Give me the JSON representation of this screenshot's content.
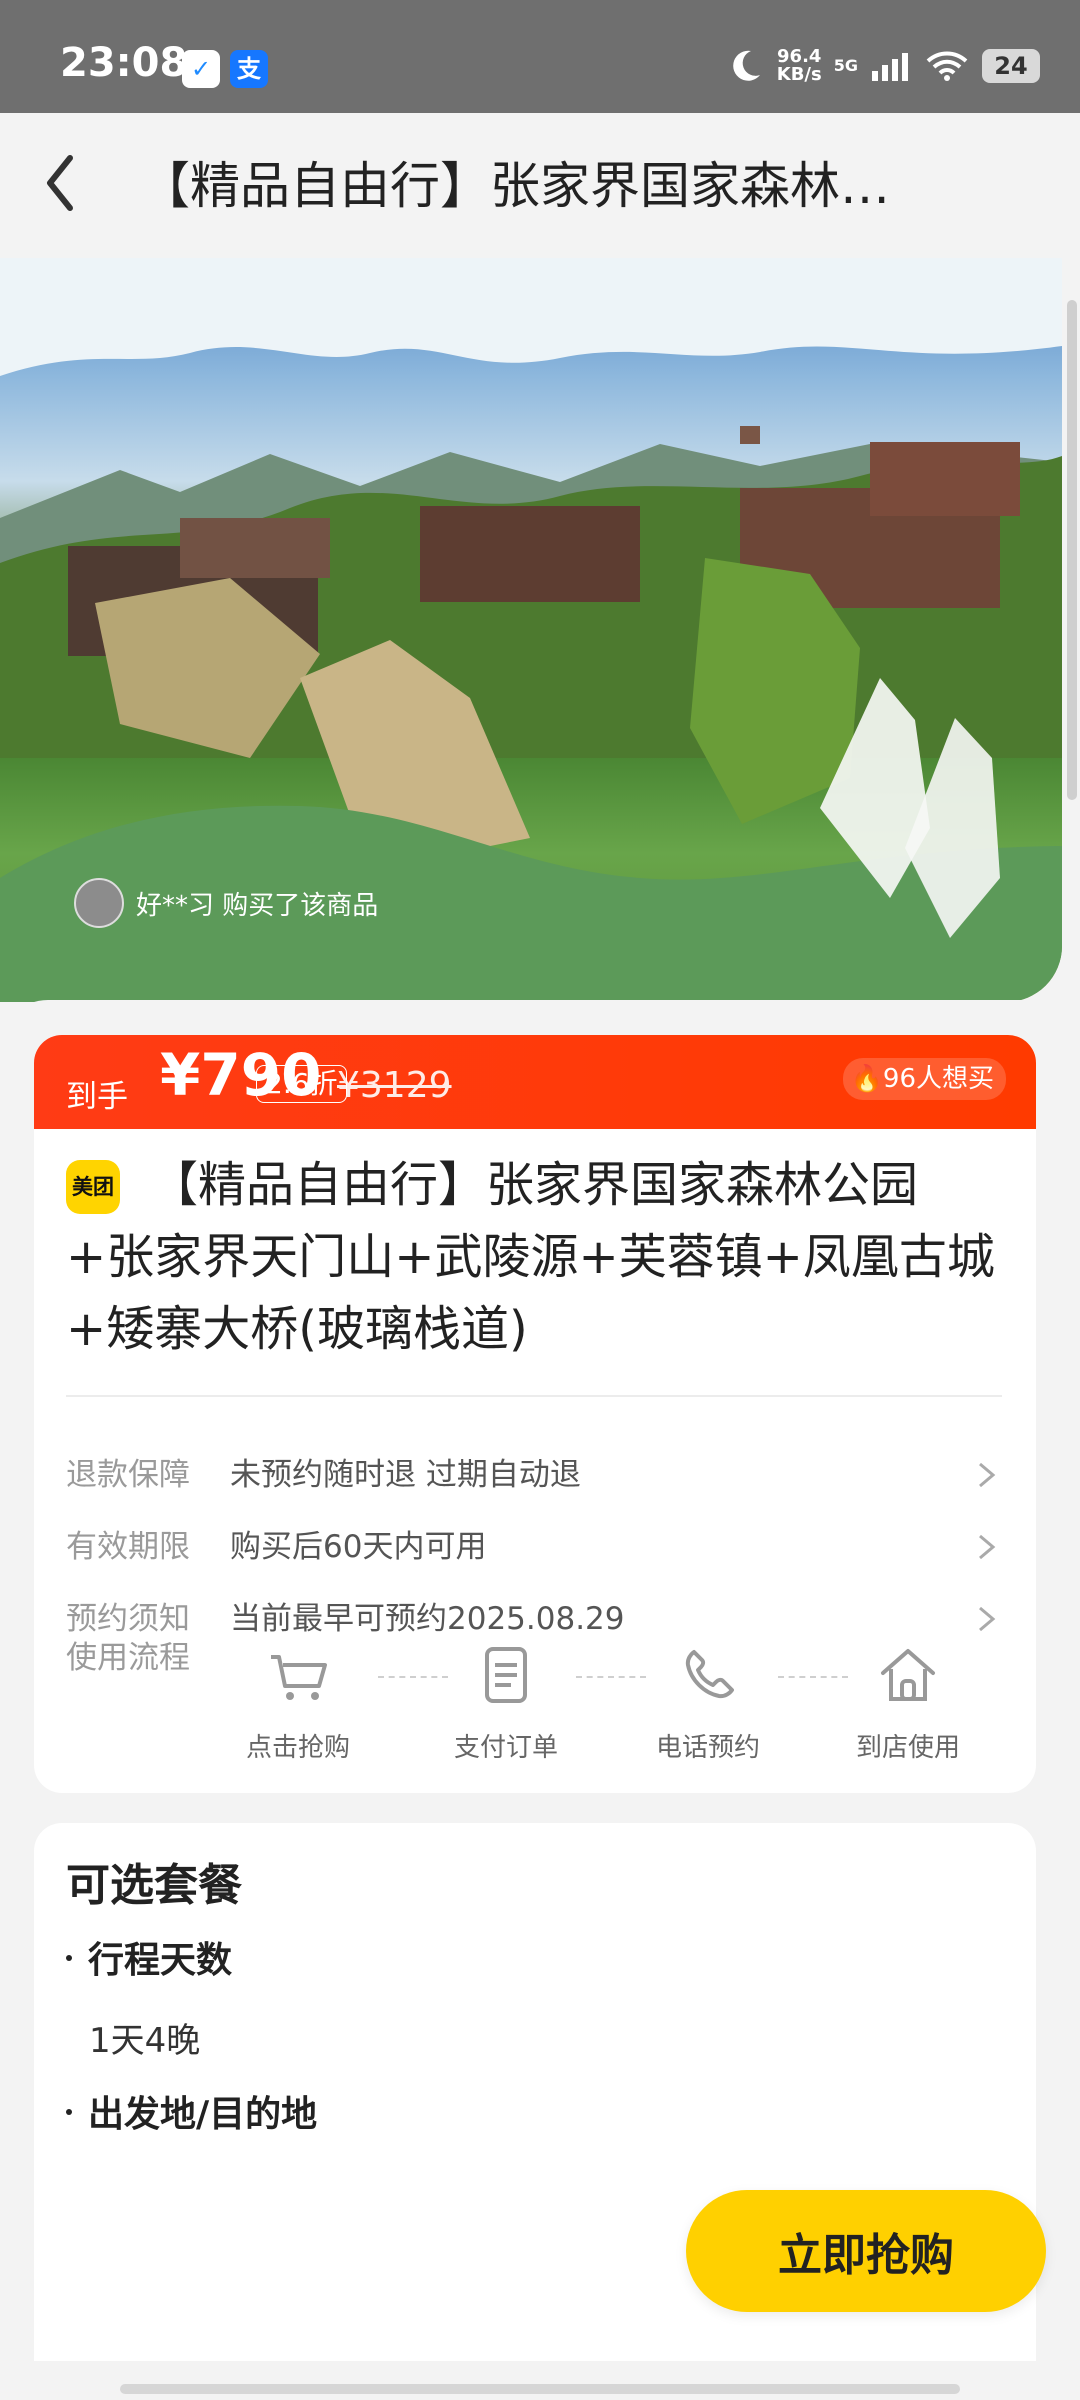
{
  "status": {
    "time": "23:08",
    "badge_1": "✓",
    "badge_2": "支",
    "speed_top": "96.4",
    "speed_bottom": "KB/s",
    "network": "5G",
    "battery": "24"
  },
  "nav": {
    "title": "【精品自由行】张家界国家森林…"
  },
  "hero": {
    "buyer_text": "好**习 购买了该商品"
  },
  "price": {
    "label": "到手",
    "currency": "¥",
    "value": "790",
    "discount": "2.6折",
    "original": "¥3129",
    "hot": "96人想买"
  },
  "product": {
    "brand": "美团",
    "title": "【精品自由行】张家界国家森林公园+张家界天门山+武陵源+芙蓉镇+凤凰古城+矮寨大桥(玻璃栈道)"
  },
  "info_rows": [
    {
      "label": "退款保障",
      "value": "未预约随时退 过期自动退"
    },
    {
      "label": "有效期限",
      "value": "购买后60天内可用"
    },
    {
      "label": "预约须知",
      "value": "当前最早可预约2025.08.29"
    }
  ],
  "process": {
    "label": "使用流程",
    "steps": [
      {
        "label": "点击抢购",
        "icon": "cart-icon"
      },
      {
        "label": "支付订单",
        "icon": "document-icon"
      },
      {
        "label": "电话预约",
        "icon": "phone-icon"
      },
      {
        "label": "到店使用",
        "icon": "home-icon"
      }
    ]
  },
  "package": {
    "section_title": "可选套餐",
    "duration_title": "行程天数",
    "duration_value": "1天4晚",
    "route_title": "出发地/目的地"
  },
  "cta": {
    "label": "立即抢购"
  }
}
